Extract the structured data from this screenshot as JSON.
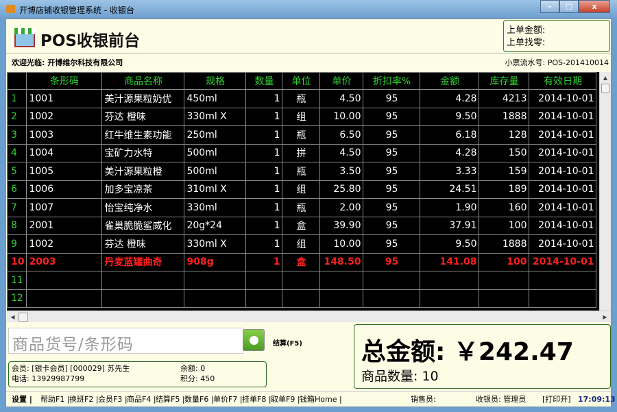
{
  "window": {
    "title": "开博店铺收银管理系统 - 收银台",
    "min": "–",
    "max": "□",
    "close": "x"
  },
  "header": {
    "title": "POS收银前台",
    "last_amount_label": "上单金额:",
    "last_change_label": "上单找零:"
  },
  "welcome": "欢迎光临: 开博维尔科技有限公司",
  "serial": "小票流水号: POS-201410014",
  "table": {
    "columns": [
      "条形码",
      "商品名称",
      "规格",
      "数量",
      "单位",
      "单价",
      "折扣率%",
      "金额",
      "库存量",
      "有效日期"
    ],
    "rows": [
      [
        "1001",
        "美汁源果粒奶优",
        "450ml",
        "1",
        "瓶",
        "4.50",
        "95",
        "4.28",
        "4213",
        "2014-10-01"
      ],
      [
        "1002",
        "芬达 橙味",
        "330ml X",
        "1",
        "组",
        "10.00",
        "95",
        "9.50",
        "1888",
        "2014-10-01"
      ],
      [
        "1003",
        "红牛维生素功能",
        "250ml",
        "1",
        "瓶",
        "6.50",
        "95",
        "6.18",
        "128",
        "2014-10-01"
      ],
      [
        "1004",
        "宝矿力水特",
        "500ml",
        "1",
        "拼",
        "4.50",
        "95",
        "4.28",
        "150",
        "2014-10-01"
      ],
      [
        "1005",
        "美汁源果粒橙",
        "500ml",
        "1",
        "瓶",
        "3.50",
        "95",
        "3.33",
        "159",
        "2014-10-01"
      ],
      [
        "1006",
        "加多宝凉茶",
        "310ml X",
        "1",
        "组",
        "25.80",
        "95",
        "24.51",
        "189",
        "2014-10-01"
      ],
      [
        "1007",
        "怡宝纯净水",
        "330ml",
        "1",
        "瓶",
        "2.00",
        "95",
        "1.90",
        "160",
        "2014-10-01"
      ],
      [
        "2001",
        "雀巢脆脆鲨威化",
        "20g*24",
        "1",
        "盒",
        "39.90",
        "95",
        "37.91",
        "100",
        "2014-10-01"
      ],
      [
        "1002",
        "芬达 橙味",
        "330ml X",
        "1",
        "组",
        "10.00",
        "95",
        "9.50",
        "1888",
        "2014-10-01"
      ],
      [
        "2003",
        "丹麦蓝罐曲奇",
        "908g",
        "1",
        "盒",
        "148.50",
        "95",
        "141.08",
        "100",
        "2014-10-01"
      ],
      [
        "",
        "",
        "",
        "",
        "",
        "",
        "",
        "",
        "",
        ""
      ],
      [
        "",
        "",
        "",
        "",
        "",
        "",
        "",
        "",
        "",
        ""
      ]
    ],
    "row_numbers": [
      "1",
      "2",
      "3",
      "4",
      "5",
      "6",
      "7",
      "8",
      "9",
      "10",
      "11",
      "12"
    ],
    "selected_row": 10
  },
  "input": {
    "placeholder": "商品货号/条形码",
    "settle_label": "结算(F5)"
  },
  "member": {
    "info": "会员: [银卡会员] [000029] 苏先生",
    "phone": "电话: 13929987799",
    "balance": "余额: 0",
    "points": "积分: 450"
  },
  "totals": {
    "amount": "总金额: ￥242.47",
    "count": "商品数量:  10"
  },
  "statusbar": {
    "items": [
      "设置 |",
      "帮助F1 |",
      "换班F2 |",
      "会员F3 |",
      "商品F4 |",
      "结算F5 |",
      "数量F6 |",
      "单价F7 |",
      "挂单F8 |",
      "取单F9 |",
      "钱箱Home |"
    ],
    "salesperson": "销售员:",
    "cashier": "收银员: 管理员",
    "print": "[打印开]",
    "time": "17:09:13"
  },
  "colors": {
    "grid_bg": "#000000",
    "header_text": "#2fd02f",
    "highlight": "#ff2020",
    "panel_bg": "#fdfde6"
  }
}
